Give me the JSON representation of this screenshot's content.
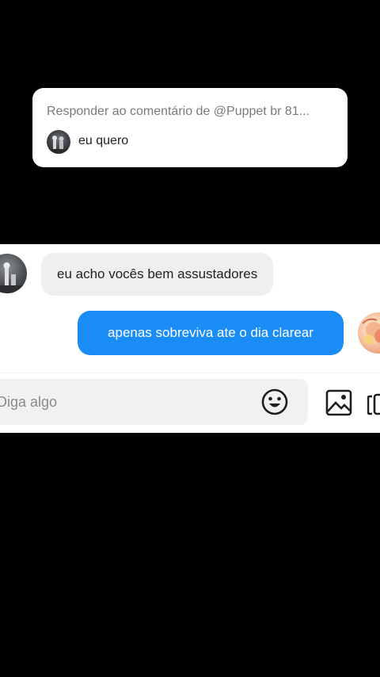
{
  "reply_card": {
    "title": "Responder ao comentário de @Puppet br 81...",
    "comment_text": "eu quero"
  },
  "chat": {
    "incoming_message": "eu acho vocês bem assustadores",
    "outgoing_message": "apenas sobreviva ate o dia clarear"
  },
  "composer": {
    "placeholder": "Diga algo"
  },
  "colors": {
    "outgoing_bubble": "#1a8cf5",
    "incoming_bubble": "#efefef",
    "background": "#000000"
  },
  "icons": {
    "emoji": "emoji-icon",
    "image": "image-icon",
    "more": "sticker-icon"
  }
}
